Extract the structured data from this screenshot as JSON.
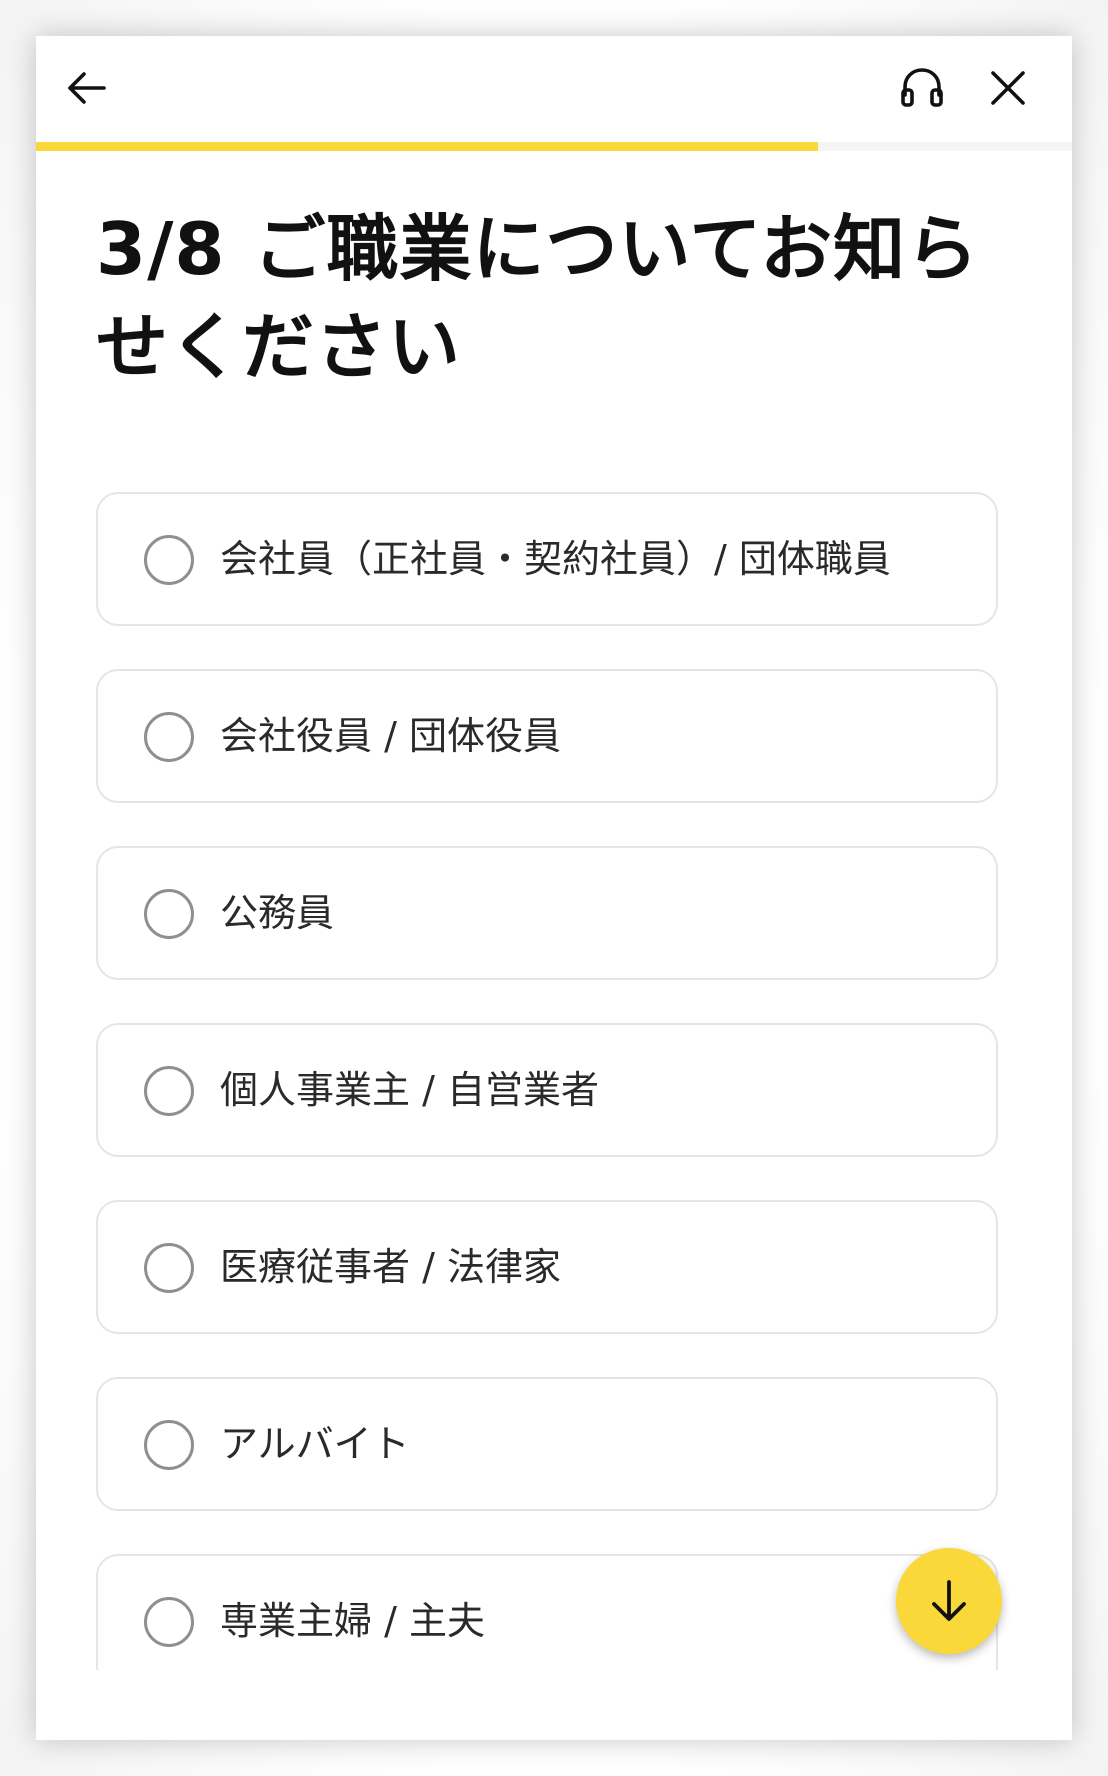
{
  "header": {
    "back_icon": "arrow-left-icon",
    "support_icon": "headset-icon",
    "close_icon": "close-icon"
  },
  "progress": {
    "current_step": 3,
    "total_steps": 8,
    "fill_fraction": 0.755,
    "color": "#fad83a"
  },
  "question": {
    "step_label": "3/8",
    "title": "ご職業についてお知らせください"
  },
  "options": [
    {
      "label": "会社員（正社員・契約社員）/ 団体職員",
      "selected": false
    },
    {
      "label": "会社役員 / 団体役員",
      "selected": false
    },
    {
      "label": "公務員",
      "selected": false
    },
    {
      "label": "個人事業主 / 自営業者",
      "selected": false
    },
    {
      "label": "医療従事者 / 法律家",
      "selected": false
    },
    {
      "label": "アルバイト",
      "selected": false
    },
    {
      "label": "専業主婦 / 主夫",
      "selected": false
    }
  ],
  "scroll_button": {
    "icon": "arrow-down-icon",
    "color": "#fad83a"
  }
}
